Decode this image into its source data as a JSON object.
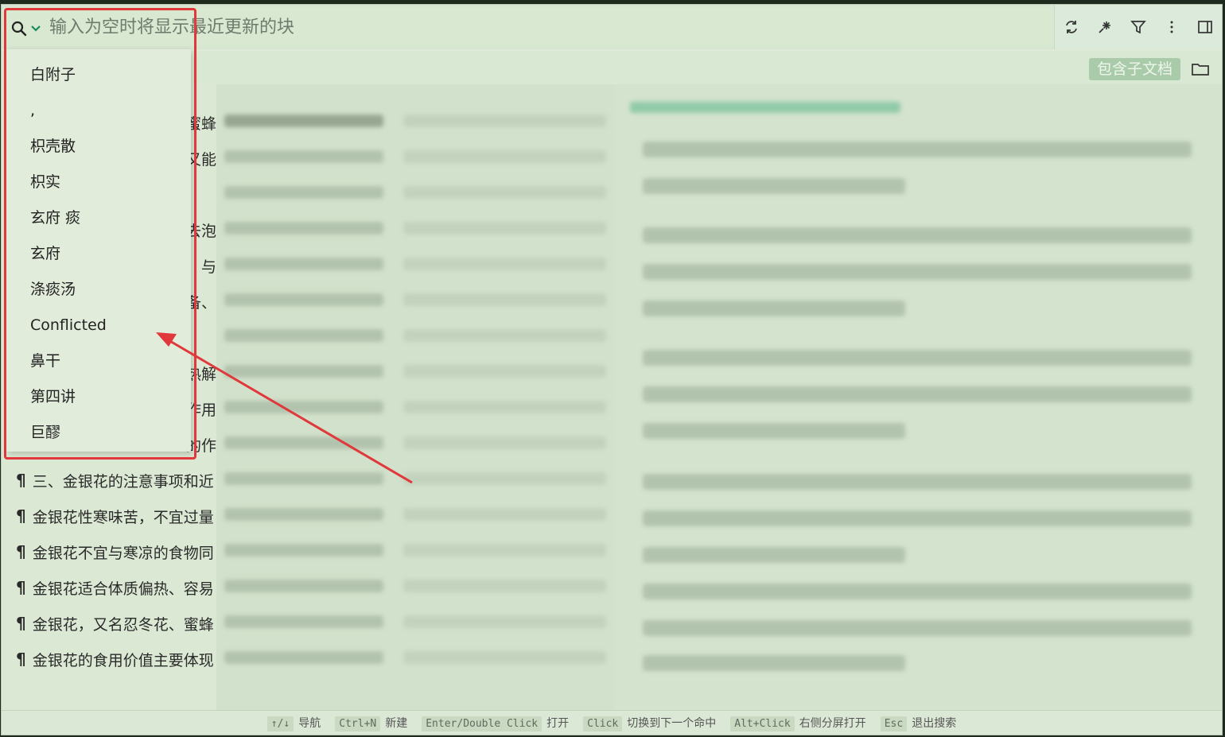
{
  "search": {
    "placeholder": "输入为空时将显示最近更新的块"
  },
  "toolbar": {
    "refresh_icon": "refresh-icon",
    "star_icon": "sparkle-icon",
    "filter_icon": "filter-icon",
    "more_icon": "more-vertical-icon",
    "layout_icon": "panel-layout-icon"
  },
  "subbar": {
    "include_children_label": "包含子文档",
    "folder_icon": "folder-icon"
  },
  "dropdown": {
    "items": [
      "白附子",
      ",",
      "枳壳散",
      "枳实",
      "玄府 痰",
      "玄府",
      "涤痰汤",
      "Conflicted",
      "鼻干",
      "第四讲",
      "巨醪"
    ]
  },
  "results": {
    "rows": [
      {
        "prefix": "",
        "text": "蜜蜂"
      },
      {
        "prefix": "",
        "text": "又能"
      },
      {
        "prefix": "",
        "text": ""
      },
      {
        "prefix": "",
        "text": "去泡"
      },
      {
        "prefix": "",
        "text": "与"
      },
      {
        "prefix": "",
        "text": "备、"
      },
      {
        "prefix": "",
        "text": ""
      },
      {
        "prefix": "",
        "text": "热解"
      },
      {
        "prefix": "",
        "text": "作用"
      },
      {
        "prefix": "",
        "text": "的作"
      },
      {
        "prefix": "¶",
        "text": "三、金银花的注意事项和近"
      },
      {
        "prefix": "¶",
        "text": "金银花性寒味苦，不宜过量"
      },
      {
        "prefix": "¶",
        "text": "金银花不宜与寒凉的食物同"
      },
      {
        "prefix": "¶",
        "text": "金银花适合体质偏热、容易"
      },
      {
        "prefix": "¶",
        "text": "金银花，又名忍冬花、蜜蜂"
      },
      {
        "prefix": "¶",
        "text": "金银花的食用价值主要体现"
      }
    ]
  },
  "statusbar": {
    "items": [
      {
        "key": "↑/↓",
        "label": "导航"
      },
      {
        "key": "Ctrl+N",
        "label": "新建"
      },
      {
        "key": "Enter/Double Click",
        "label": "打开"
      },
      {
        "key": "Click",
        "label": "切换到下一个命中"
      },
      {
        "key": "Alt+Click",
        "label": "右侧分屏打开"
      },
      {
        "key": "Esc",
        "label": "退出搜索"
      }
    ]
  },
  "colors": {
    "accent_red": "#e0383b",
    "tag_bg": "#aacbaa",
    "panel_bg": "#dfead8"
  }
}
